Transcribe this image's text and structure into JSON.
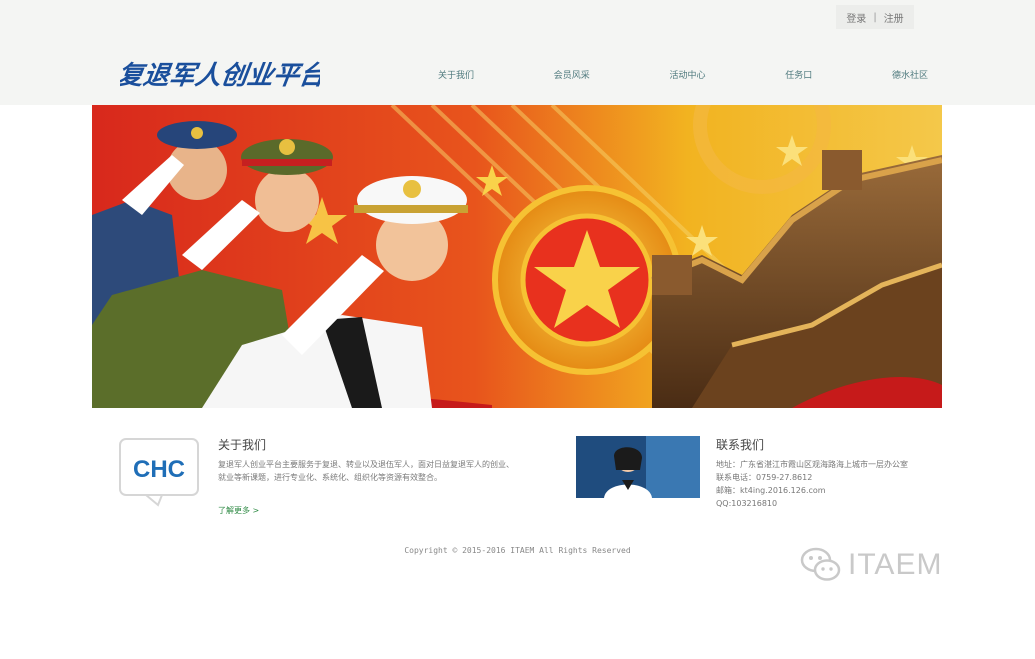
{
  "header": {
    "logo_text": "复退军人创业平台",
    "top_links": [
      "登录",
      "注册"
    ],
    "top_separator": "|"
  },
  "nav": {
    "items": [
      "关于我们",
      "会员风采",
      "活动中心",
      "任务口",
      "德水社区"
    ]
  },
  "about": {
    "icon_label": "CHC",
    "title": "关于我们",
    "text": "复退军人创业平台主要服务于复退、转业以及退伍军人，面对日益复退军人的创业、就业等新课题，进行专业化、系统化、组织化等资源有效整合。",
    "more": "了解更多 >"
  },
  "contact": {
    "title": "联系我们",
    "address": "地址：广东省湛江市霞山区观海路海上城市一层办公室",
    "phone": "联系电话：0759-27.8612",
    "email": "邮箱：kt4ing.2016.126.com",
    "qq": "QQ:103216810"
  },
  "footer": {
    "copyright": "Copyright © 2015-2016 ITAEM All Rights Reserved"
  },
  "watermark": {
    "text": "ITAEM"
  },
  "colors": {
    "nav_link": "#4f7a7e",
    "logo_blue": "#1a4f9c",
    "banner_red": "#c61a1a",
    "banner_gold": "#f2b320",
    "more_link": "#2e8a44"
  },
  "icons": [
    "chc-logo-icon",
    "wechat-icon"
  ]
}
